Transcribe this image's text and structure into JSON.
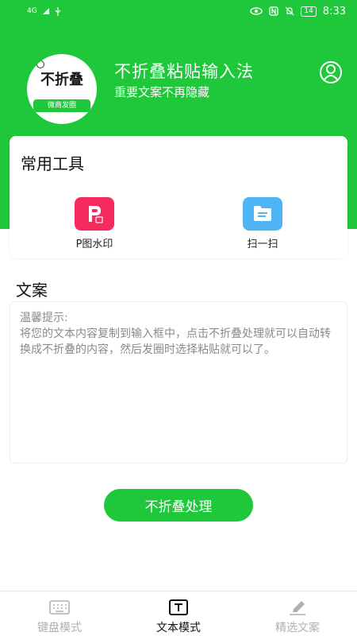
{
  "status_bar": {
    "network": "4G",
    "battery": "14",
    "time": "8:33"
  },
  "header": {
    "logo_text": "不折叠",
    "logo_subtext": "微商发圈",
    "title": "不折叠粘贴输入法",
    "subtitle": "重要文案不再隐藏",
    "profile_icon": "user-icon"
  },
  "tools": {
    "title": "常用工具",
    "items": [
      {
        "label": "P图水印",
        "icon": "p-watermark-icon",
        "color": "#f72a5e"
      },
      {
        "label": "扫一扫",
        "icon": "scan-icon",
        "color": "#4fb4f6"
      }
    ]
  },
  "copy_section": {
    "title": "文案",
    "placeholder": "温馨提示:\n将您的文本内容复制到输入框中，点击不折叠处理就可以自动转换成不折叠的内容，然后发圈时选择粘贴就可以了。"
  },
  "actions": {
    "process_label": "不折叠处理"
  },
  "tab_bar": {
    "tabs": [
      {
        "label": "键盘模式",
        "icon": "keyboard-icon",
        "active": false
      },
      {
        "label": "文本模式",
        "icon": "text-icon",
        "active": true
      },
      {
        "label": "精选文案",
        "icon": "pencil-icon",
        "active": false
      }
    ]
  },
  "colors": {
    "brand_green": "#1ec83a",
    "inactive_tab": "#b0b0b0"
  }
}
